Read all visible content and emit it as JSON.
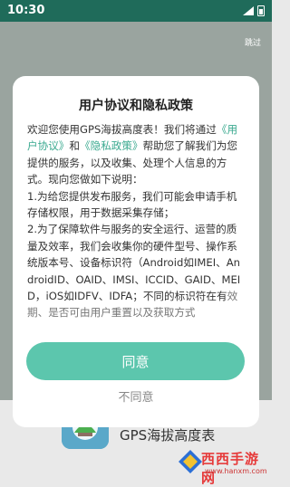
{
  "status_bar": {
    "time": "10:30"
  },
  "splash": {
    "skip_label": "跳过"
  },
  "footer": {
    "app_name": "GPS海拔高度表"
  },
  "watermark": {
    "title": "西西手游网",
    "url": "www.hanxm.com"
  },
  "dialog": {
    "title": "用户协议和隐私政策",
    "body": {
      "intro_1": "欢迎您使用GPS海拔高度表！我们将通过",
      "link_user_agreement": "《用户协议》",
      "and": "和",
      "link_privacy_policy": "《隐私政策》",
      "intro_2": "帮助您了解我们为您提供的服务，以及收集、处理个人信息的方式。现向您做如下说明：",
      "item_1": "1.为给您提供发布服务，我们可能会申请手机存储权限，用于数据采集存储；",
      "item_2": "2.为了保障软件与服务的安全运行、运营的质量及效率，我们会收集你的硬件型号、操作系统版本号、设备标识符（Android如IMEI、AndroidID、OAID、IMSI、ICCID、GAID、MEID，iOS如IDFV、IDFA；不同的标识符在有",
      "item_2_tail": "效期、是否可由用户重置以及获取方式"
    },
    "agree_label": "同意",
    "disagree_label": "不同意"
  },
  "colors": {
    "status_bar": "#1f6b5a",
    "accent": "#5cc6ad",
    "link": "#3aa98f",
    "overlay": "#9aa49f"
  },
  "icons": [
    "signal-icon",
    "battery-icon",
    "app-icon",
    "watermark-logo-icon"
  ]
}
